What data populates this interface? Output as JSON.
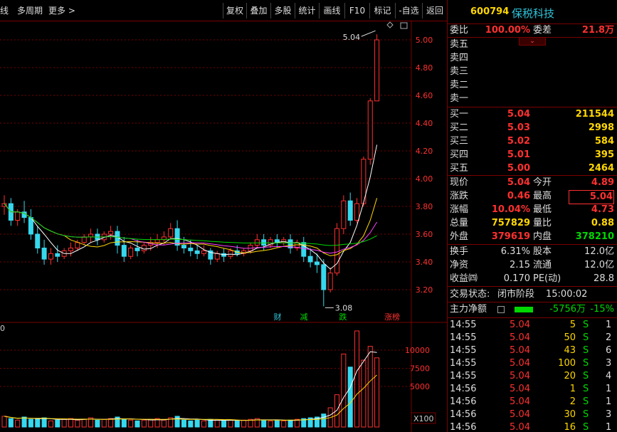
{
  "toolbar": {
    "left_items": [
      "线",
      "多周期",
      "更多 >"
    ],
    "buttons": [
      "复权",
      "叠加",
      "多股",
      "统计",
      "画线",
      "F10",
      "标记",
      "-自选",
      "返回"
    ]
  },
  "chart_data": {
    "type": "candlestick",
    "y_ticks": [
      "5.00",
      "4.80",
      "4.60",
      "4.40",
      "4.20",
      "4.00",
      "3.80",
      "3.60",
      "3.40",
      "3.20"
    ],
    "ylim": [
      3.08,
      5.04
    ],
    "high_label": "5.04",
    "low_label": "3.08",
    "event_labels": [
      {
        "text": "财",
        "color": "#2ec4d9"
      },
      {
        "text": "减",
        "color": "#00d800"
      },
      {
        "text": "跌",
        "color": "#00d800"
      },
      {
        "text": "涨榜",
        "color": "#ff3030"
      }
    ],
    "volume_axis_label": "0",
    "volume_ticks": [
      "10000",
      "7500",
      "5000"
    ],
    "volume_unit": "X100",
    "candles": [
      [
        3.8,
        3.88,
        3.82,
        3.74
      ],
      [
        3.82,
        3.86,
        3.7,
        3.66
      ],
      [
        3.7,
        3.78,
        3.76,
        3.66
      ],
      [
        3.76,
        3.84,
        3.72,
        3.68
      ],
      [
        3.72,
        3.78,
        3.6,
        3.56
      ],
      [
        3.6,
        3.66,
        3.5,
        3.46
      ],
      [
        3.5,
        3.56,
        3.42,
        3.38
      ],
      [
        3.42,
        3.5,
        3.46,
        3.38
      ],
      [
        3.46,
        3.52,
        3.44,
        3.4
      ],
      [
        3.44,
        3.5,
        3.48,
        3.42
      ],
      [
        3.48,
        3.54,
        3.5,
        3.44
      ],
      [
        3.5,
        3.56,
        3.54,
        3.48
      ],
      [
        3.54,
        3.6,
        3.58,
        3.52
      ],
      [
        3.58,
        3.64,
        3.6,
        3.54
      ],
      [
        3.6,
        3.64,
        3.56,
        3.52
      ],
      [
        3.56,
        3.62,
        3.6,
        3.54
      ],
      [
        3.6,
        3.66,
        3.62,
        3.56
      ],
      [
        3.62,
        3.66,
        3.52,
        3.46
      ],
      [
        3.52,
        3.58,
        3.44,
        3.4
      ],
      [
        3.44,
        3.52,
        3.5,
        3.42
      ],
      [
        3.5,
        3.56,
        3.48,
        3.44
      ],
      [
        3.48,
        3.54,
        3.52,
        3.46
      ],
      [
        3.52,
        3.58,
        3.54,
        3.48
      ],
      [
        3.54,
        3.6,
        3.56,
        3.5
      ],
      [
        3.56,
        3.62,
        3.58,
        3.52
      ],
      [
        3.58,
        3.68,
        3.64,
        3.56
      ],
      [
        3.64,
        3.7,
        3.52,
        3.48
      ],
      [
        3.52,
        3.58,
        3.5,
        3.46
      ],
      [
        3.5,
        3.56,
        3.48,
        3.44
      ],
      [
        3.48,
        3.52,
        3.46,
        3.42
      ],
      [
        3.46,
        3.52,
        3.48,
        3.44
      ],
      [
        3.48,
        3.5,
        3.42,
        3.38
      ],
      [
        3.42,
        3.48,
        3.46,
        3.4
      ],
      [
        3.46,
        3.5,
        3.44,
        3.4
      ],
      [
        3.44,
        3.5,
        3.48,
        3.42
      ],
      [
        3.48,
        3.52,
        3.46,
        3.44
      ],
      [
        3.46,
        3.5,
        3.48,
        3.44
      ],
      [
        3.48,
        3.54,
        3.52,
        3.46
      ],
      [
        3.52,
        3.6,
        3.56,
        3.5
      ],
      [
        3.56,
        3.6,
        3.52,
        3.48
      ],
      [
        3.52,
        3.58,
        3.56,
        3.5
      ],
      [
        3.56,
        3.6,
        3.54,
        3.5
      ],
      [
        3.54,
        3.58,
        3.56,
        3.52
      ],
      [
        3.56,
        3.6,
        3.5,
        3.46
      ],
      [
        3.5,
        3.56,
        3.54,
        3.48
      ],
      [
        3.54,
        3.58,
        3.44,
        3.4
      ],
      [
        3.44,
        3.5,
        3.4,
        3.36
      ],
      [
        3.4,
        3.46,
        3.38,
        3.32
      ],
      [
        3.38,
        3.42,
        3.2,
        3.08
      ],
      [
        3.2,
        3.36,
        3.32,
        3.18
      ],
      [
        3.32,
        3.68,
        3.64,
        3.3
      ],
      [
        3.64,
        3.88,
        3.84,
        3.6
      ],
      [
        3.84,
        3.9,
        3.7,
        3.66
      ],
      [
        3.7,
        3.86,
        3.82,
        3.68
      ],
      [
        3.82,
        4.16,
        4.14,
        3.8
      ],
      [
        4.14,
        4.58,
        4.56,
        4.1
      ],
      [
        4.56,
        5.04,
        5.0,
        4.74
      ]
    ],
    "volumes": [
      1400,
      1100,
      900,
      1300,
      1000,
      1100,
      1200,
      800,
      900,
      1000,
      1100,
      900,
      1000,
      1200,
      900,
      1000,
      1100,
      1300,
      1000,
      900,
      800,
      900,
      1000,
      1100,
      900,
      1200,
      1400,
      900,
      800,
      900,
      800,
      1000,
      900,
      800,
      900,
      800,
      900,
      1000,
      1100,
      900,
      800,
      900,
      800,
      900,
      1000,
      1100,
      1200,
      1300,
      1700,
      2500,
      4200,
      9500,
      7800,
      12500,
      8700,
      10500,
      9000
    ],
    "ma_lines": [
      {
        "name": "MA5",
        "color": "#ffffff"
      },
      {
        "name": "MA10",
        "color": "#ffd700"
      },
      {
        "name": "MA20",
        "color": "#ff40ff"
      },
      {
        "name": "MA60",
        "color": "#00d800"
      }
    ]
  },
  "stock": {
    "code": "600794",
    "name": "保税科技"
  },
  "weibi": {
    "label1": "委比",
    "value1": "100.00%",
    "label2": "委差",
    "value2": "21.8万"
  },
  "sell_levels": [
    "卖五",
    "卖四",
    "卖三",
    "卖二",
    "卖一"
  ],
  "buy_levels": [
    {
      "label": "买一",
      "price": "5.04",
      "volume": "211544"
    },
    {
      "label": "买二",
      "price": "5.03",
      "volume": "2998"
    },
    {
      "label": "买三",
      "price": "5.02",
      "volume": "584"
    },
    {
      "label": "买四",
      "price": "5.01",
      "volume": "395"
    },
    {
      "label": "买五",
      "price": "5.00",
      "volume": "2464"
    }
  ],
  "quote": [
    {
      "l1": "现价",
      "v1": "5.04",
      "c1": "red",
      "l2": "今开",
      "v2": "4.89",
      "c2": "red"
    },
    {
      "l1": "涨跌",
      "v1": "0.46",
      "c1": "red",
      "l2": "最高",
      "v2": "5.04",
      "c2": "red"
    },
    {
      "l1": "涨幅",
      "v1": "10.04%",
      "c1": "red",
      "l2": "最低",
      "v2": "4.73",
      "c2": "red"
    },
    {
      "l1": "总量",
      "v1": "757829",
      "c1": "yel",
      "l2": "量比",
      "v2": "0.88",
      "c2": "yel"
    },
    {
      "l1": "外盘",
      "v1": "379619",
      "c1": "red",
      "l2": "内盘",
      "v2": "378210",
      "c2": "green"
    }
  ],
  "fundamentals": [
    {
      "l1": "换手",
      "v1": "6.31%",
      "l2": "股本",
      "v2": "12.0亿"
    },
    {
      "l1": "净资",
      "v1": "2.15",
      "l2": "流通",
      "v2": "12.0亿"
    },
    {
      "l1": "收益㈣",
      "v1": "0.170",
      "l2": "PE(动)",
      "v2": "28.8"
    }
  ],
  "status": {
    "label": "交易状态:",
    "value": "闭市阶段",
    "time": "15:00:02"
  },
  "main_net": {
    "label": "主力净额",
    "value": "-5756万",
    "pct": "-15%"
  },
  "ticks": [
    {
      "time": "14:55",
      "price": "5.04",
      "vol": "5",
      "side": "S",
      "n": "1"
    },
    {
      "time": "14:55",
      "price": "5.04",
      "vol": "50",
      "side": "S",
      "n": "2"
    },
    {
      "time": "14:55",
      "price": "5.04",
      "vol": "43",
      "side": "S",
      "n": "6"
    },
    {
      "time": "14:55",
      "price": "5.04",
      "vol": "100",
      "side": "S",
      "n": "3"
    },
    {
      "time": "14:55",
      "price": "5.04",
      "vol": "20",
      "side": "S",
      "n": "4"
    },
    {
      "time": "14:56",
      "price": "5.04",
      "vol": "1",
      "side": "S",
      "n": "1"
    },
    {
      "time": "14:56",
      "price": "5.04",
      "vol": "2",
      "side": "S",
      "n": "1"
    },
    {
      "time": "14:56",
      "price": "5.04",
      "vol": "30",
      "side": "S",
      "n": "3"
    },
    {
      "time": "14:56",
      "price": "5.04",
      "vol": "16",
      "side": "S",
      "n": "1"
    }
  ]
}
